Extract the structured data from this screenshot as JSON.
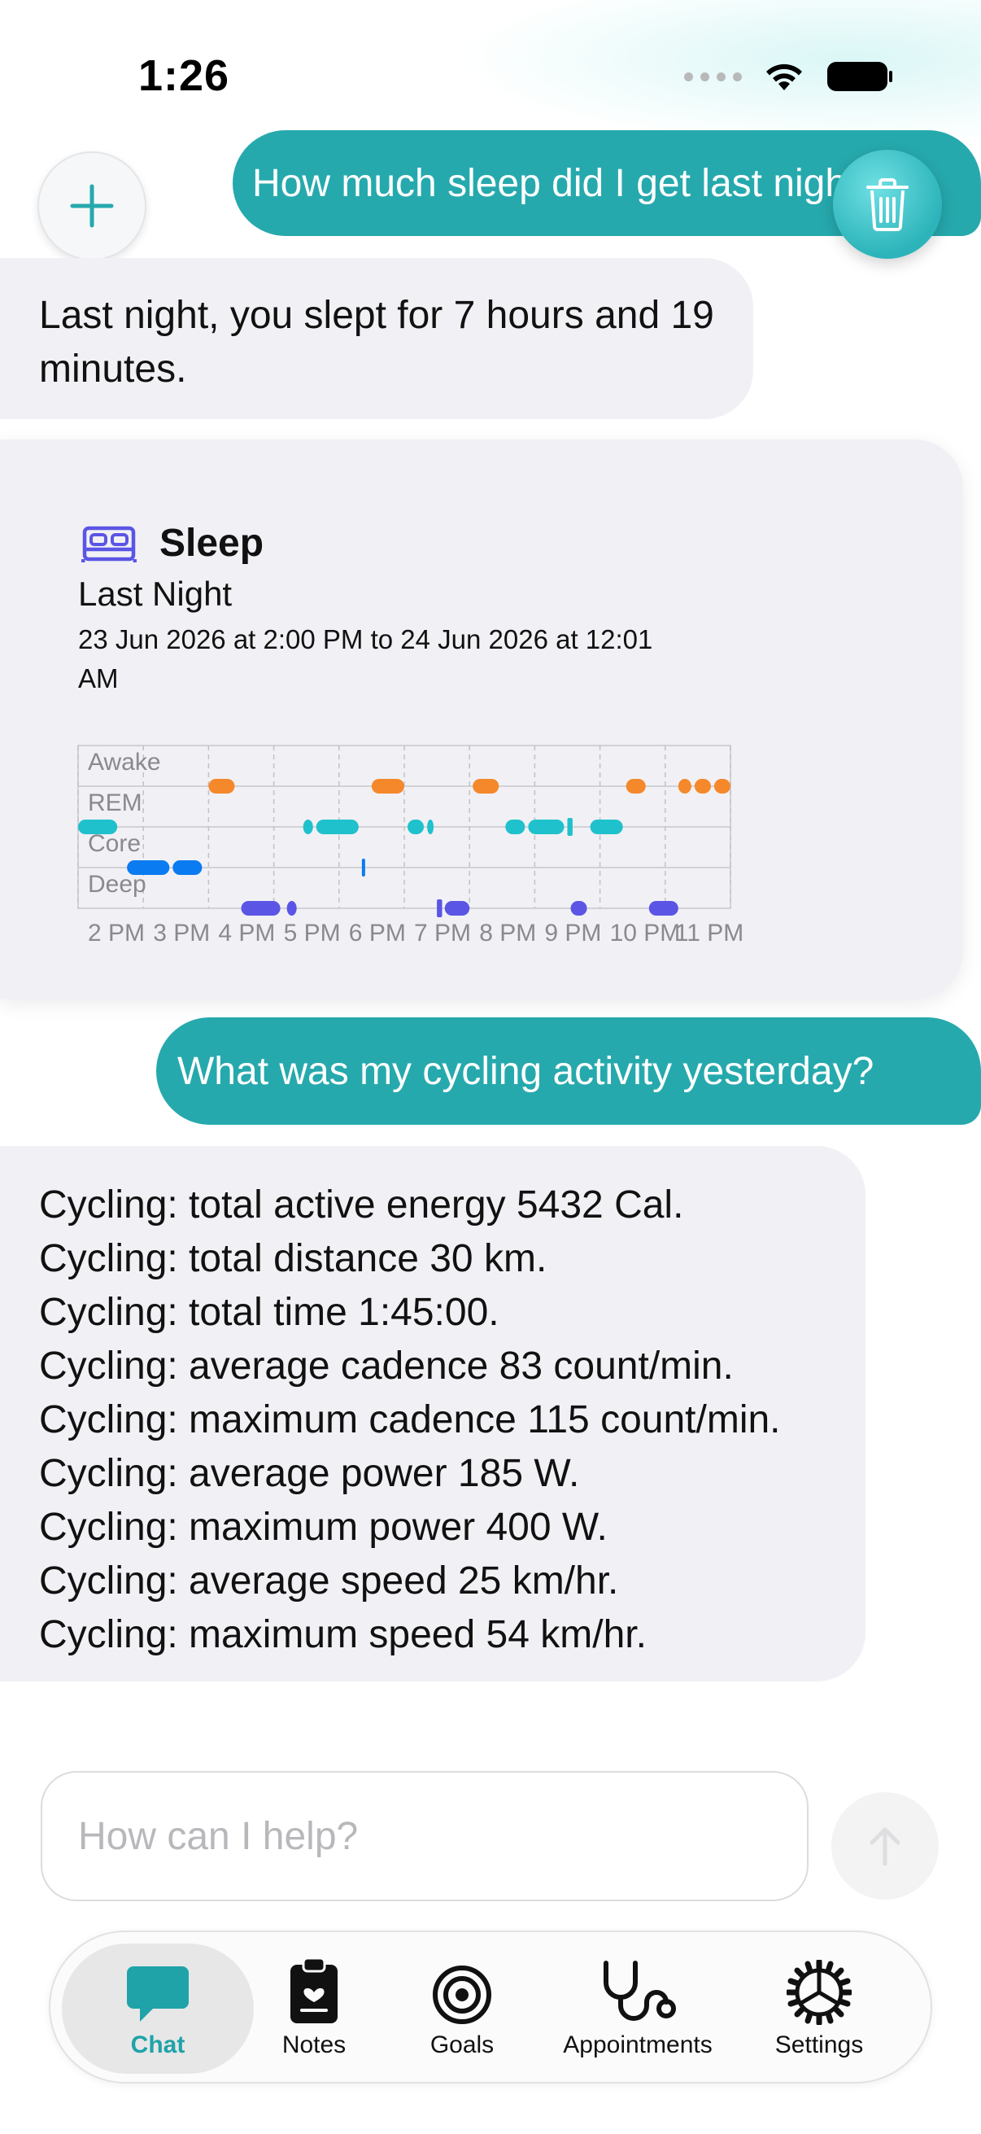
{
  "status_bar": {
    "time": "1:26"
  },
  "messages": {
    "user_1": "How much sleep did I get last night?",
    "bot_1": "Last night, you slept for 7 hours and 19 minutes.",
    "user_2": "What was my cycling activity yesterday?",
    "bot_2_lines": [
      "Cycling: total active energy 5432 Cal.",
      "Cycling: total distance 30 km.",
      "Cycling: total time 1:45:00.",
      "Cycling: average cadence 83 count/min.",
      "Cycling: maximum cadence 115 count/min.",
      "Cycling: average power 185 W.",
      "Cycling: maximum power 400 W.",
      "Cycling: average speed 25 km/hr.",
      "Cycling: maximum speed 54 km/hr."
    ]
  },
  "sleep_card": {
    "title": "Sleep",
    "subtitle": "Last Night",
    "range": "23 Jun 2026 at 2:00 PM to 24 Jun 2026 at 12:01 AM",
    "icon": "bed-icon"
  },
  "chart_data": {
    "type": "timeline",
    "stages": [
      "Awake",
      "REM",
      "Core",
      "Deep"
    ],
    "x_ticks": [
      "2 PM",
      "3 PM",
      "4 PM",
      "5 PM",
      "6 PM",
      "7 PM",
      "8 PM",
      "9 PM",
      "10 PM",
      "11 PM"
    ],
    "x_range_hours": [
      14,
      24
    ],
    "colors": {
      "Awake": "#f5882a",
      "REM": "#1fc1cc",
      "Core": "#0a7bf0",
      "Deep": "#5b55e6"
    },
    "segments": [
      {
        "stage": "REM",
        "start": 14.0,
        "end": 14.6
      },
      {
        "stage": "Core",
        "start": 14.75,
        "end": 15.4
      },
      {
        "stage": "Core",
        "start": 15.45,
        "end": 15.9
      },
      {
        "stage": "Awake",
        "start": 16.0,
        "end": 16.4
      },
      {
        "stage": "Deep",
        "start": 16.5,
        "end": 17.1
      },
      {
        "stage": "Deep",
        "start": 17.2,
        "end": 17.35
      },
      {
        "stage": "REM",
        "start": 17.45,
        "end": 17.6
      },
      {
        "stage": "REM",
        "start": 17.65,
        "end": 18.3
      },
      {
        "stage": "Core",
        "start": 18.35,
        "end": 18.38
      },
      {
        "stage": "Awake",
        "start": 18.5,
        "end": 19.0
      },
      {
        "stage": "REM",
        "start": 19.05,
        "end": 19.3
      },
      {
        "stage": "REM",
        "start": 19.35,
        "end": 19.45
      },
      {
        "stage": "Deep",
        "start": 19.5,
        "end": 19.58
      },
      {
        "stage": "Deep",
        "start": 19.62,
        "end": 20.0
      },
      {
        "stage": "Awake",
        "start": 20.05,
        "end": 20.45
      },
      {
        "stage": "REM",
        "start": 20.55,
        "end": 20.85
      },
      {
        "stage": "REM",
        "start": 20.9,
        "end": 21.45
      },
      {
        "stage": "REM",
        "start": 21.5,
        "end": 21.58
      },
      {
        "stage": "Deep",
        "start": 21.55,
        "end": 21.8
      },
      {
        "stage": "REM",
        "start": 21.85,
        "end": 22.35
      },
      {
        "stage": "Awake",
        "start": 22.4,
        "end": 22.7
      },
      {
        "stage": "Deep",
        "start": 22.75,
        "end": 23.2
      },
      {
        "stage": "Awake",
        "start": 23.2,
        "end": 23.4
      },
      {
        "stage": "Awake",
        "start": 23.45,
        "end": 23.7
      },
      {
        "stage": "Awake",
        "start": 23.75,
        "end": 24.0
      }
    ]
  },
  "input": {
    "placeholder": "How can I help?"
  },
  "tabs": [
    {
      "label": "Chat",
      "icon": "chat-bubble-icon",
      "active": true
    },
    {
      "label": "Notes",
      "icon": "clipboard-heart-icon",
      "active": false
    },
    {
      "label": "Goals",
      "icon": "target-icon",
      "active": false
    },
    {
      "label": "Appointments",
      "icon": "stethoscope-icon",
      "active": false
    },
    {
      "label": "Settings",
      "icon": "gear-icon",
      "active": false
    }
  ],
  "colors": {
    "accent": "#26a9ad",
    "bubble_bg": "#f1f1f5"
  }
}
